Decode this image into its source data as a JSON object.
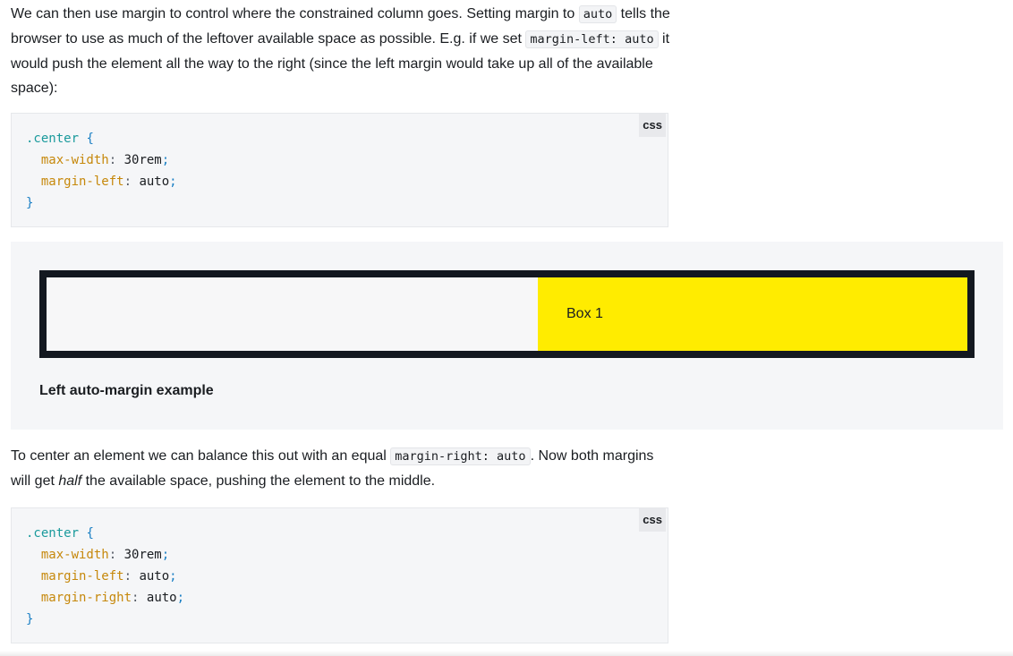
{
  "para1": {
    "part1": "We can then use margin to control where the constrained column goes. Setting margin to ",
    "code1": "auto",
    "part2": " tells the browser to use as much of the leftover available space as possible. E.g. if we set ",
    "code2": "margin-left: auto",
    "part3": " it would push the element all the way to the right (since the left margin would take up all of the available space):"
  },
  "code_block_1": {
    "lang": "css",
    "selector": ".center",
    "open_brace": "{",
    "close_brace": "}",
    "decl1_prop": "max-width",
    "decl1_val": "30rem",
    "decl2_prop": "margin-left",
    "decl2_val": "auto"
  },
  "demo": {
    "box_label": "Box 1",
    "caption": "Left auto-margin example",
    "box_color": "#ffec00",
    "border_color": "#131820"
  },
  "para2": {
    "part1": "To center an element we can balance this out with an equal ",
    "code1": "margin-right: auto",
    "part2": ". Now both margins will get ",
    "emph": "half",
    "part3": " the available space, pushing the element to the middle."
  },
  "code_block_2": {
    "lang": "css",
    "selector": ".center",
    "open_brace": "{",
    "close_brace": "}",
    "decl1_prop": "max-width",
    "decl1_val": "30rem",
    "decl2_prop": "margin-left",
    "decl2_val": "auto",
    "decl3_prop": "margin-right",
    "decl3_val": "auto"
  }
}
